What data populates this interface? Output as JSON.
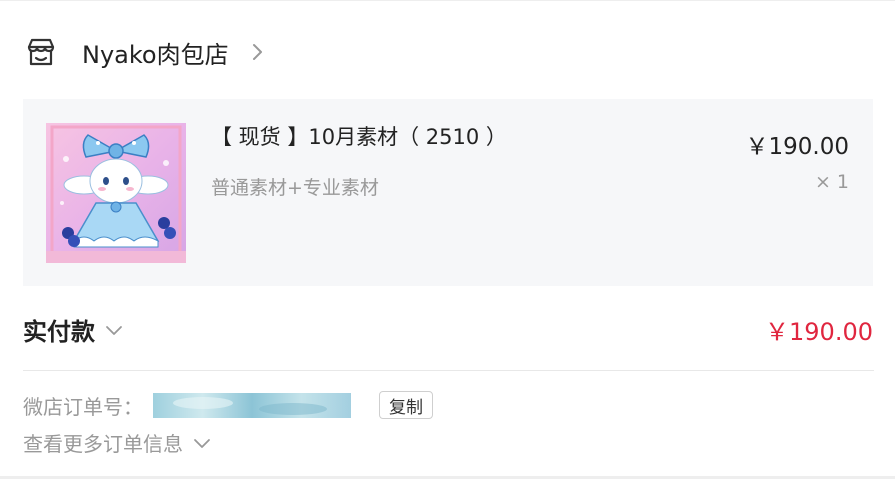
{
  "shop": {
    "name": "Nyako肉包店",
    "icon": "storefront-icon"
  },
  "product": {
    "title": "【 现货 】10月素材（ 2510 ）",
    "spec": "普通素材+专业素材",
    "price": "￥190.00",
    "quantity": "× 1",
    "image_icon": "product-thumbnail"
  },
  "payment": {
    "label": "实付款",
    "amount": "￥190.00"
  },
  "order": {
    "number_label": "微店订单号：",
    "copy_label": "复制",
    "more_label": "查看更多订单信息"
  },
  "colors": {
    "accent_red": "#e0263f",
    "card_bg": "#f6f7f9",
    "muted_text": "#999999"
  }
}
